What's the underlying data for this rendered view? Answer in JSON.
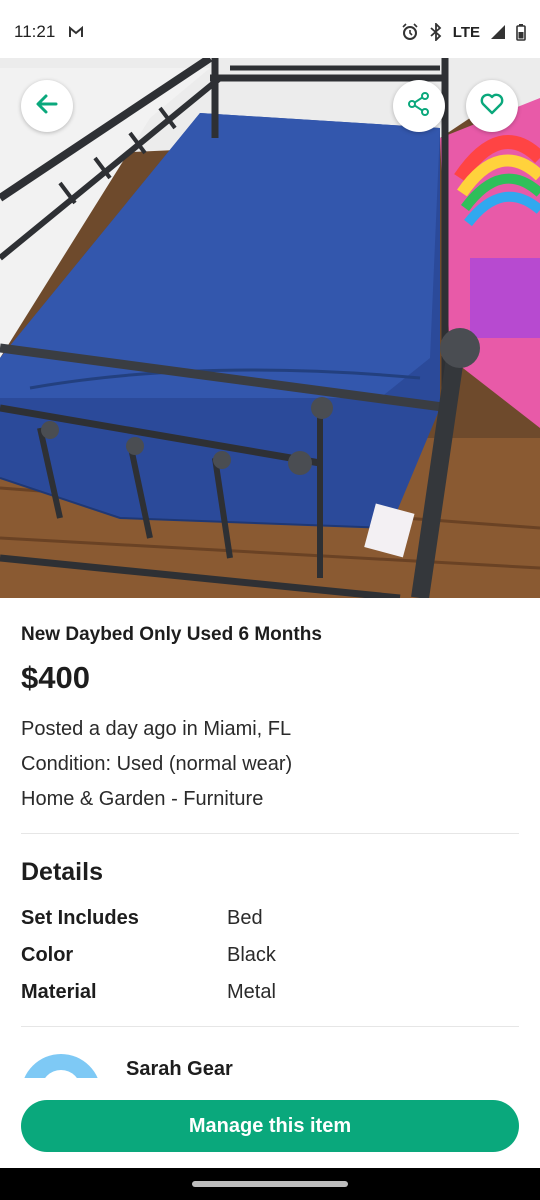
{
  "status_bar": {
    "time": "11:21",
    "notification_icon": "gmail-icon",
    "network": "LTE",
    "icons": [
      "alarm-icon",
      "bluetooth-icon",
      "signal-icon",
      "battery-icon"
    ]
  },
  "hero": {
    "image_desc": "photo-of-daybed",
    "back_icon": "arrow-left-icon",
    "share_icon": "share-icon",
    "favorite_icon": "heart-icon"
  },
  "listing": {
    "title": "New Daybed Only Used 6 Months",
    "price": "$400",
    "posted": "Posted a day ago in Miami, FL",
    "condition": "Condition: Used (normal wear)",
    "category": "Home & Garden - Furniture"
  },
  "details": {
    "heading": "Details",
    "rows": [
      {
        "label": "Set Includes",
        "value": "Bed"
      },
      {
        "label": "Color",
        "value": "Black"
      },
      {
        "label": "Material",
        "value": "Metal"
      }
    ]
  },
  "seller": {
    "name": "Sarah Gear"
  },
  "actions": {
    "manage_label": "Manage this item"
  },
  "colors": {
    "accent": "#0aa87c",
    "mattress": "#2b4a9a"
  }
}
